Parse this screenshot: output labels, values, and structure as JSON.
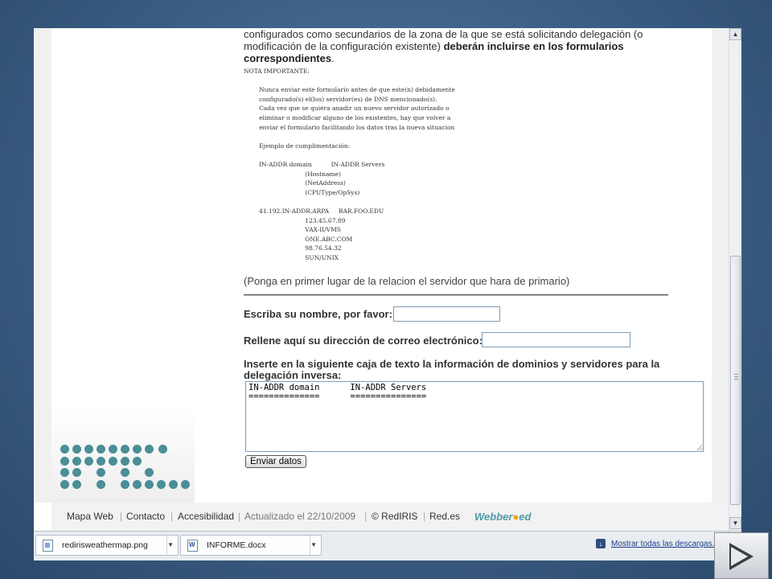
{
  "intro": {
    "line1": "configurados como secundarios de la zona de la que se está solicitando delegación (o",
    "line2_plain": "modificación de la configuración existente) ",
    "line2_bold": "deberán incluirse en los formularios",
    "line3_bold": "correspondientes",
    "line3_end": "."
  },
  "note_text": "NOTA IMPORTANTE:\n\n        Nunca enviar este formulario antes de que este(n) debidamente\n        configurado(s) el(los) servidor(es) de DNS mencionado(s).\n        Cada vez que se quiera anadir un nuevo servidor autorizado o\n        eliminar o modificar alguno de los existentes, hay que volver a\n        enviar el formulario facilitando los datos tras la nueva situacion\n\n        Ejemplo de cumplimentación:\n\n        IN-ADDR domain          IN-ADDR Servers\n                                (Hostname)\n                                (NetAddress)\n                                (CPUType/OpSys)\n\n        41.192.IN-ADDR.ARPA     BAR.FOO.EDU\n                                123.45.67.89\n                                VAX-II/VMS\n                                ONE.ABC.COM\n                                98.76.54.32\n                                SUN/UNIX",
  "hint": "(Ponga en primer lugar de la relacion el servidor que hara de primario)",
  "form": {
    "name_label": "Escriba su nombre, por favor:",
    "name_value": "",
    "email_label": "Rellene aquí su dirección de correo electrónico:",
    "email_value": "",
    "info_label_line1": "Inserte en la siguiente caja de texto la información de dominios y servidores para la",
    "info_label_line2": "delegación inversa:",
    "textarea_value": "IN-ADDR domain      IN-ADDR Servers\n==============      ===============",
    "submit_label": "Enviar datos"
  },
  "footer": {
    "links": [
      "Mapa Web",
      "Contacto",
      "Accesibilidad"
    ],
    "updated": "Actualizado el 22/10/2009",
    "copyright": "© RedIRIS",
    "site": "Red.es",
    "logo": "Webber",
    "logo_end": "ed"
  },
  "downloads": {
    "items": [
      {
        "name": "redirisweathermap.png",
        "icon": "image-file-icon"
      },
      {
        "name": "INFORME.docx",
        "icon": "word-file-icon"
      }
    ],
    "show_all": "Mostrar todas las descargas..."
  },
  "colors": {
    "dots": "#4a8e96",
    "logo": "#4e9aa5",
    "background": "#3c5e83"
  }
}
